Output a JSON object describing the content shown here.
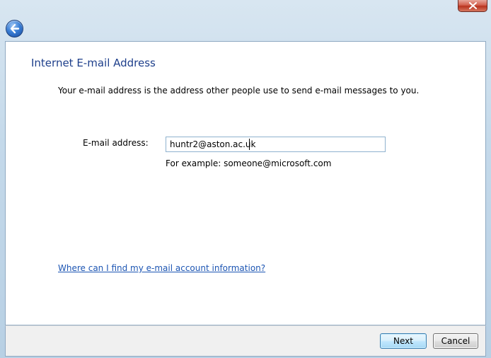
{
  "window": {
    "heading": "Internet E-mail Address",
    "description": "Your e-mail address is the address other people use to send e-mail messages to you."
  },
  "form": {
    "email_label": "E-mail address:",
    "email_value": "huntr2@aston.ac.uk",
    "example_text": "For example: someone@microsoft.com"
  },
  "help": {
    "link_text": "Where can I find my e-mail account information?"
  },
  "buttons": {
    "next": "Next",
    "cancel": "Cancel"
  },
  "icons": {
    "close": "close-icon",
    "back": "back-arrow-icon"
  },
  "colors": {
    "heading": "#1e3f8b",
    "link": "#1c55b3",
    "close_button": "#c74532",
    "back_button": "#3a7fd6"
  }
}
